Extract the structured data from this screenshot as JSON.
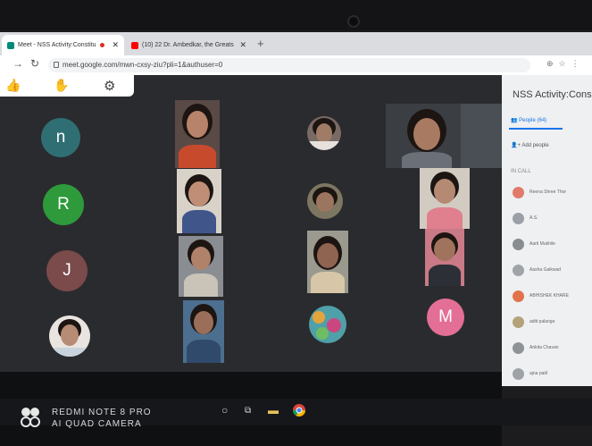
{
  "browser": {
    "tabs": [
      {
        "title": "Meet - NSS Activity:Constitu",
        "active": true
      },
      {
        "title": "(10) 22 Dr. Ambedkar, the Greats",
        "active": false
      }
    ],
    "new_tab": "+",
    "url": "meet.google.com/mwn-cxsy-ziu?pli=1&authuser=0"
  },
  "meet": {
    "toolbar_icons": [
      "thumbs-up-icon",
      "raise-hand-icon",
      "settings-gear-icon"
    ],
    "tiles": [
      {
        "kind": "avatar",
        "initial": "n",
        "color": "#2f6f73"
      },
      {
        "kind": "avatar",
        "initial": "R",
        "color": "#2e9a3b"
      },
      {
        "kind": "avatar",
        "initial": "J",
        "color": "#7b4a4a"
      },
      {
        "kind": "avatar",
        "initial": "M",
        "color": "#e46f96"
      }
    ],
    "sidebar": {
      "title": "NSS Activity:Cons",
      "people_tab": "People (64)",
      "add_people": "Add people",
      "section": "IN CALL",
      "participants": [
        {
          "name": "Reena Shree Thor",
          "color": "#e07a6a"
        },
        {
          "name": "A.S.",
          "color": "#9aa0a6"
        },
        {
          "name": "Aarti Mukhile",
          "color": "#8a8d90"
        },
        {
          "name": "Aasha Gaikwad",
          "color": "#a0a4a8"
        },
        {
          "name": "ABHISHEK KHARE",
          "color": "#e0734c"
        },
        {
          "name": "aditi palange",
          "color": "#b3a27a"
        },
        {
          "name": "Ankita Chavan",
          "color": "#8f9398"
        },
        {
          "name": "ajna patil",
          "color": "#9fa3a7"
        }
      ]
    }
  },
  "taskbar": {
    "icons": [
      "search-circle-icon",
      "task-view-icon",
      "file-explorer-icon",
      "chrome-icon"
    ]
  },
  "watermark": {
    "line1": "REDMI NOTE 8 PRO",
    "line2": "AI QUAD CAMERA"
  }
}
